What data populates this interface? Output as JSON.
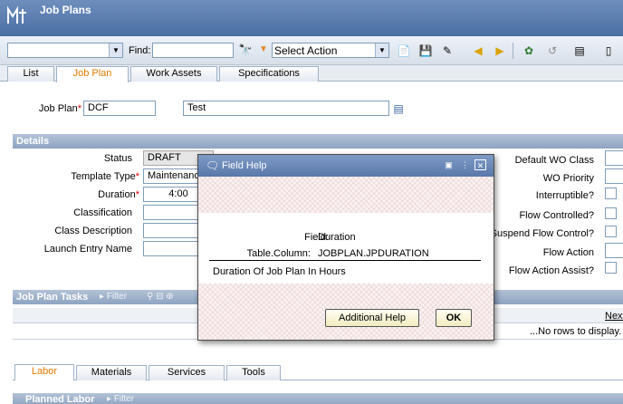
{
  "app": {
    "title": "Job Plans"
  },
  "toolbar": {
    "find_label": "Find:",
    "find_value": "",
    "query_value": "",
    "action_value": "Select Action"
  },
  "tabs": [
    {
      "label": "List"
    },
    {
      "label": "Job Plan"
    },
    {
      "label": "Work Assets"
    },
    {
      "label": "Specifications"
    }
  ],
  "header": {
    "jobplan_label": "Job Plan",
    "jobplan_value": "DCF",
    "description_value": "Test"
  },
  "details": {
    "title": "Details",
    "status_label": "Status",
    "status_value": "DRAFT",
    "template_type_label": "Template Type",
    "template_type_value": "Maintenance",
    "duration_label": "Duration",
    "duration_value": "4:00",
    "classification_label": "Classification",
    "class_description_label": "Class Description",
    "launch_entry_label": "Launch Entry Name",
    "default_wo_class_label": "Default WO Class",
    "wo_priority_label": "WO Priority",
    "interruptible_label": "Interruptible?",
    "flow_controlled_label": "Flow Controlled?",
    "suspend_flow_label": "Suspend Flow Control?",
    "flow_action_label": "Flow Action",
    "flow_action_assist_label": "Flow Action Assist?"
  },
  "tasks": {
    "title": "Job Plan Tasks",
    "filter_label": "Filter",
    "next_label": "Next",
    "empty_text": "...No rows to display."
  },
  "bottom_tabs": [
    {
      "label": "Labor"
    },
    {
      "label": "Materials"
    },
    {
      "label": "Services"
    },
    {
      "label": "Tools"
    }
  ],
  "planned_labor": {
    "title": "Planned Labor",
    "filter_label": "Filter"
  },
  "dialog": {
    "title": "Field Help",
    "field_label": "Field:",
    "field_value": "Duration",
    "table_column_label": "Table.Column:",
    "table_column_value": "JOBPLAN.JPDURATION",
    "description": "Duration Of Job Plan In Hours",
    "additional_help_label": "Additional Help",
    "ok_label": "OK"
  }
}
